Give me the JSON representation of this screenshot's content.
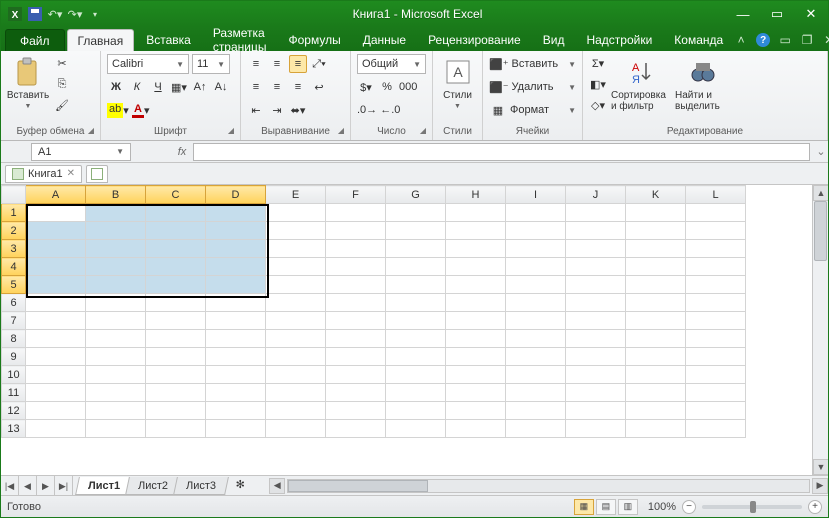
{
  "title": "Книга1 - Microsoft Excel",
  "qat": {
    "save": "save",
    "undo": "undo",
    "redo": "redo"
  },
  "winbtns": {
    "min": "—",
    "max": "▭",
    "close": "✕"
  },
  "file_tab": "Файл",
  "tabs": [
    "Главная",
    "Вставка",
    "Разметка страницы",
    "Формулы",
    "Данные",
    "Рецензирование",
    "Вид",
    "Надстройки",
    "Команда"
  ],
  "active_tab": 0,
  "ribbon": {
    "clipboard": {
      "label": "Буфер обмена",
      "paste": "Вставить"
    },
    "font": {
      "label": "Шрифт",
      "name": "Calibri",
      "size": "11",
      "bold": "Ж",
      "italic": "К",
      "underline": "Ч"
    },
    "align": {
      "label": "Выравнивание"
    },
    "number": {
      "label": "Число",
      "format": "Общий"
    },
    "styles": {
      "label": "Стили",
      "btn": "Стили"
    },
    "cells": {
      "label": "Ячейки",
      "insert": "Вставить",
      "delete": "Удалить",
      "format": "Формат"
    },
    "editing": {
      "label": "Редактирование",
      "sort": "Сортировка и фильтр",
      "find": "Найти и выделить"
    }
  },
  "namebox": "A1",
  "fx": "fx",
  "workbook_tab": "Книга1",
  "columns": [
    "A",
    "B",
    "C",
    "D",
    "E",
    "F",
    "G",
    "H",
    "I",
    "J",
    "K",
    "L"
  ],
  "rows": [
    "1",
    "2",
    "3",
    "4",
    "5",
    "6",
    "7",
    "8",
    "9",
    "10",
    "11",
    "12",
    "13"
  ],
  "selection": {
    "cols": [
      "A",
      "B",
      "C",
      "D"
    ],
    "rows": [
      "1",
      "2",
      "3",
      "4",
      "5"
    ],
    "active": "A1"
  },
  "sheets": [
    "Лист1",
    "Лист2",
    "Лист3"
  ],
  "active_sheet": 0,
  "status": {
    "ready": "Готово",
    "zoom": "100%"
  }
}
